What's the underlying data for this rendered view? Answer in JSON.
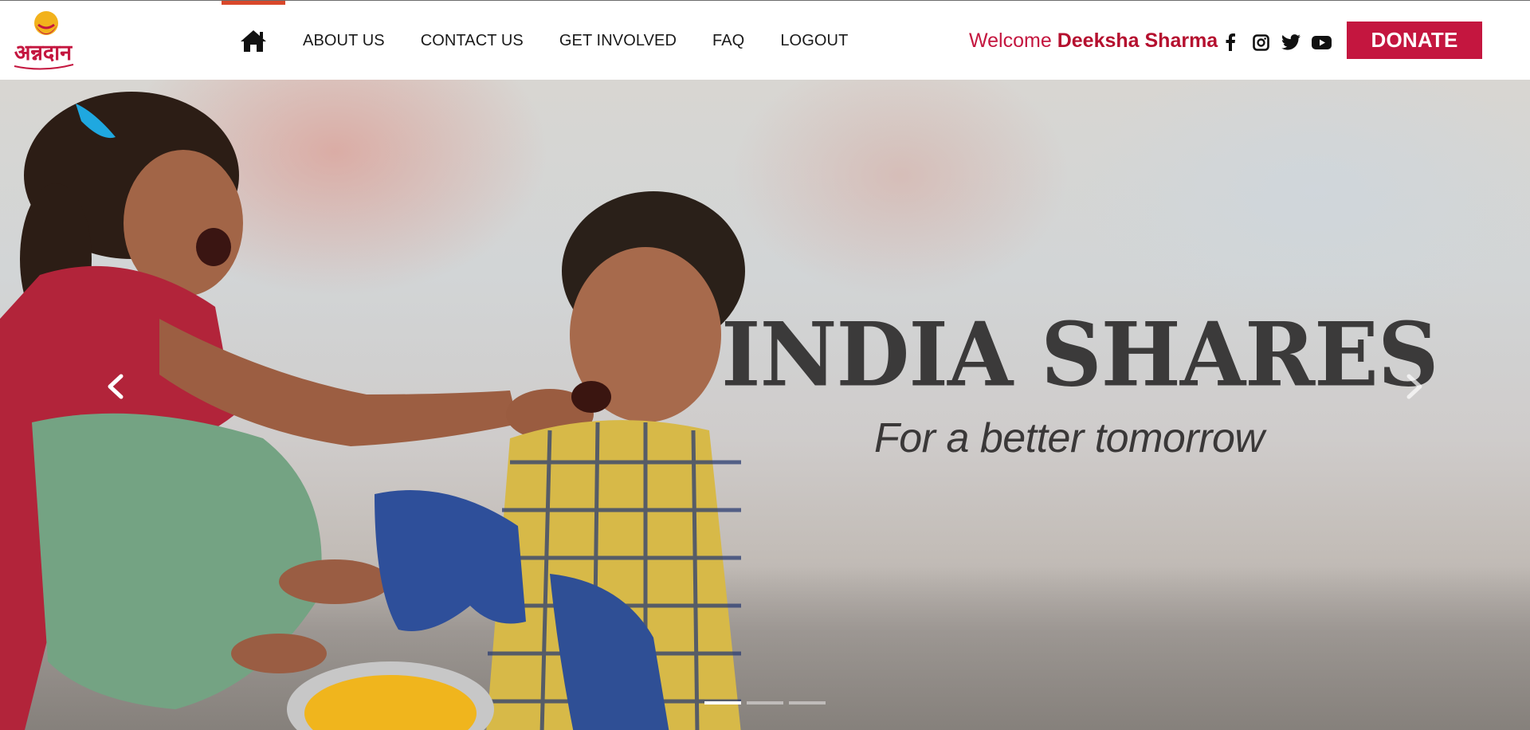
{
  "header": {
    "logo_text": "अन्नदान",
    "nav": {
      "home_icon": "home-icon",
      "items": [
        {
          "label": "ABOUT US"
        },
        {
          "label": "CONTACT US"
        },
        {
          "label": "GET INVOLVED"
        },
        {
          "label": "FAQ"
        },
        {
          "label": "LOGOUT"
        }
      ]
    },
    "welcome_prefix": "Welcome",
    "user_name": "Deeksha Sharma",
    "social": [
      {
        "icon": "facebook-icon"
      },
      {
        "icon": "instagram-icon"
      },
      {
        "icon": "twitter-icon"
      },
      {
        "icon": "youtube-icon"
      }
    ],
    "donate_label": "DONATE"
  },
  "hero": {
    "title": "INDIA SHARES",
    "subtitle": "For a better tomorrow",
    "prev_icon": "chevron-left-icon",
    "next_icon": "chevron-right-icon",
    "slides_total": 3,
    "active_slide": 1
  },
  "colors": {
    "brand": "#c4163f",
    "active_nav_bar": "#d9482b",
    "text_dark": "#1a1a1a",
    "hero_text": "#3b3a3a"
  }
}
